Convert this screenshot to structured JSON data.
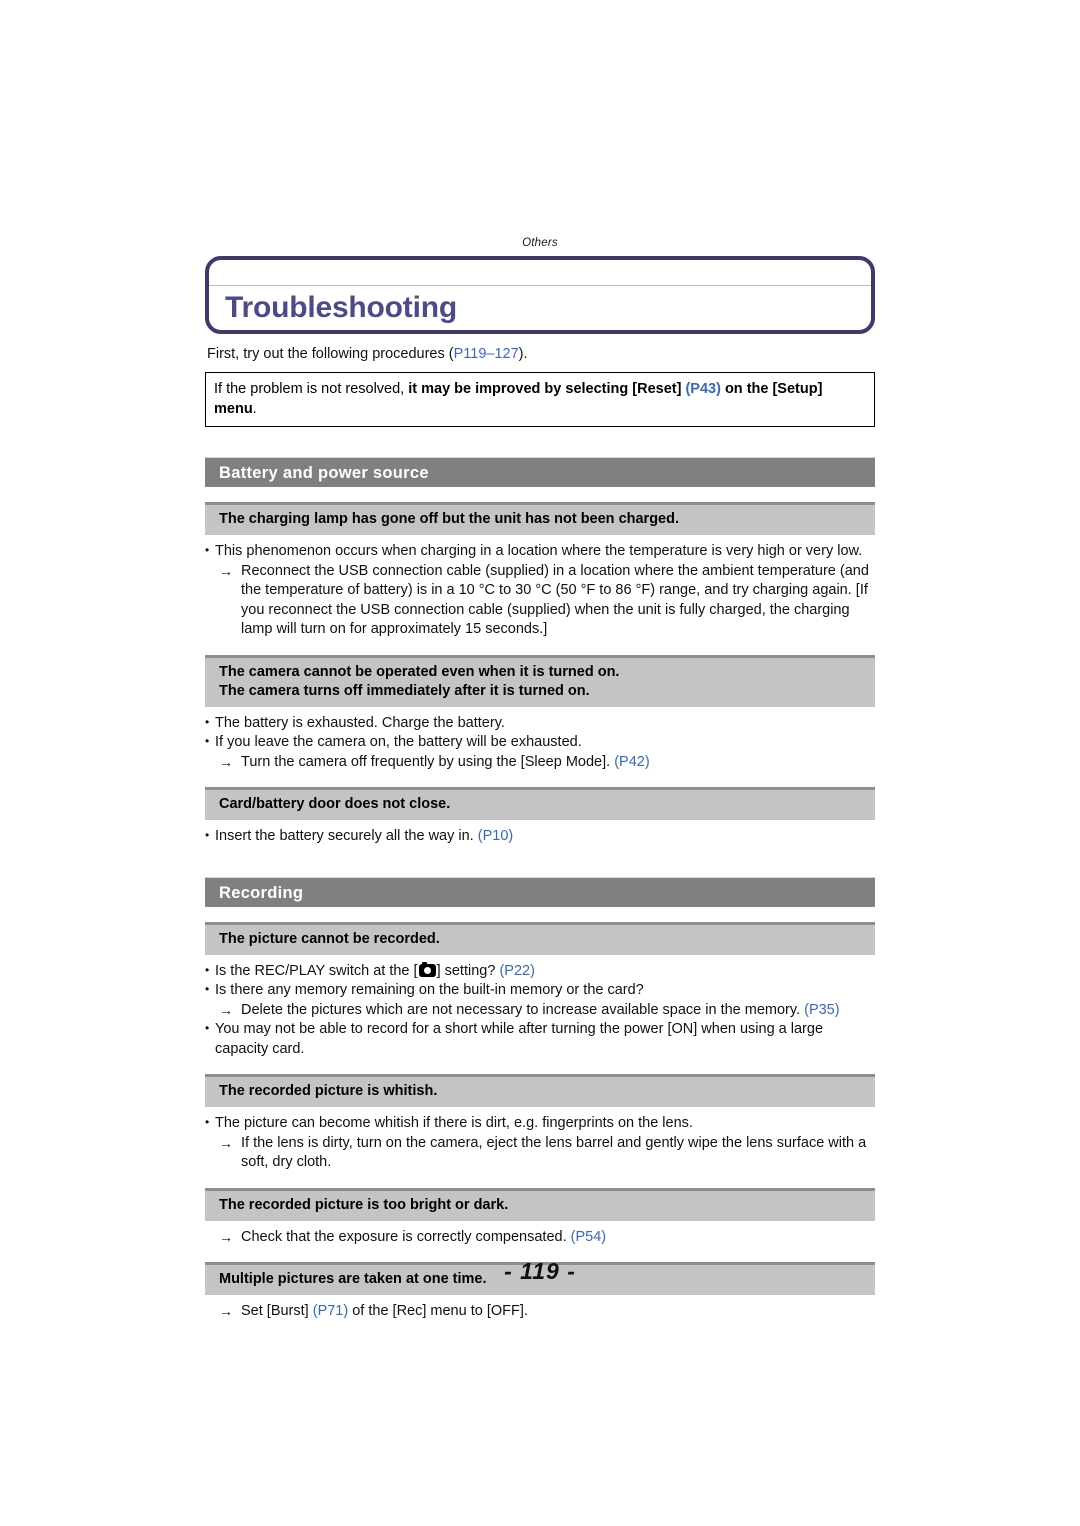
{
  "running_head": "Others",
  "title": "Troubleshooting",
  "intro": {
    "before": "First, try out the following procedures (",
    "ref": "P119–127",
    "after": ")."
  },
  "note": {
    "plain_start": "If the problem is not resolved, ",
    "bold_mid": "it may be improved by selecting [Reset] ",
    "ref": "(P43)",
    "bold_end": " on the [Setup] menu",
    "period": "."
  },
  "sections": [
    {
      "heading": "Battery and power source",
      "items": [
        {
          "title_lines": [
            "The charging lamp has gone off but the unit has not been charged."
          ],
          "body": [
            {
              "kind": "bullet",
              "text": "This phenomenon occurs when charging in a location where the temperature is very high or very low."
            },
            {
              "kind": "arrow",
              "text": "Reconnect the USB connection cable (supplied) in a location where the ambient temperature (and the temperature of battery) is in a 10 °C to 30 °C (50 °F to 86 °F) range, and try charging again. [If you reconnect the USB connection cable (supplied) when the unit is fully charged, the charging lamp will turn on for approximately 15 seconds.]"
            }
          ]
        },
        {
          "title_lines": [
            "The camera cannot be operated even when it is turned on.",
            "The camera turns off immediately after it is turned on."
          ],
          "body": [
            {
              "kind": "bullet",
              "text": "The battery is exhausted. Charge the battery."
            },
            {
              "kind": "bullet",
              "text": "If you leave the camera on, the battery will be exhausted."
            },
            {
              "kind": "arrow",
              "text": "Turn the camera off frequently by using the [Sleep Mode]. ",
              "ref": "(P42)"
            }
          ]
        },
        {
          "title_lines": [
            "Card/battery door does not close."
          ],
          "body": [
            {
              "kind": "bullet",
              "text": "Insert the battery securely all the way in. ",
              "ref": "(P10)"
            }
          ]
        }
      ]
    },
    {
      "heading": "Recording",
      "items": [
        {
          "title_lines": [
            "The picture cannot be recorded."
          ],
          "body": [
            {
              "kind": "bullet-camera",
              "text_before": "Is the REC/PLAY switch at the [",
              "icon": "camera-icon",
              "text_after": "] setting? ",
              "ref": "(P22)"
            },
            {
              "kind": "bullet",
              "text": "Is there any memory remaining on the built-in memory or the card?"
            },
            {
              "kind": "arrow",
              "text": "Delete the pictures which are not necessary to increase available space in the memory. ",
              "ref": "(P35)"
            },
            {
              "kind": "bullet",
              "text": "You may not be able to record for a short while after turning the power [ON] when using a large capacity card."
            }
          ]
        },
        {
          "title_lines": [
            "The recorded picture is whitish."
          ],
          "body": [
            {
              "kind": "bullet",
              "text": "The picture can become whitish if there is dirt, e.g. fingerprints on the lens."
            },
            {
              "kind": "arrow",
              "text": "If the lens is dirty, turn on the camera, eject the lens barrel and gently wipe the lens surface with a soft, dry cloth."
            }
          ]
        },
        {
          "title_lines": [
            "The recorded picture is too bright or dark."
          ],
          "body": [
            {
              "kind": "arrow",
              "text": "Check that the exposure is correctly compensated. ",
              "ref": "(P54)"
            }
          ]
        },
        {
          "title_lines": [
            "Multiple pictures are taken at one time."
          ],
          "body": [
            {
              "kind": "arrow",
              "text_before": "Set [Burst] ",
              "ref_mid": "(P71)",
              "text_after": " of the [Rec] menu to [OFF]."
            }
          ]
        }
      ]
    }
  ],
  "page_number": "- 119 -",
  "colors": {
    "title_border": "#3b3a6e",
    "title_text": "#4b4b8c",
    "section_bar": "#808080",
    "sub_bar": "#c4c4c4",
    "sub_bar_top": "#8e8e8e",
    "reference_blue": "#3668c8"
  }
}
